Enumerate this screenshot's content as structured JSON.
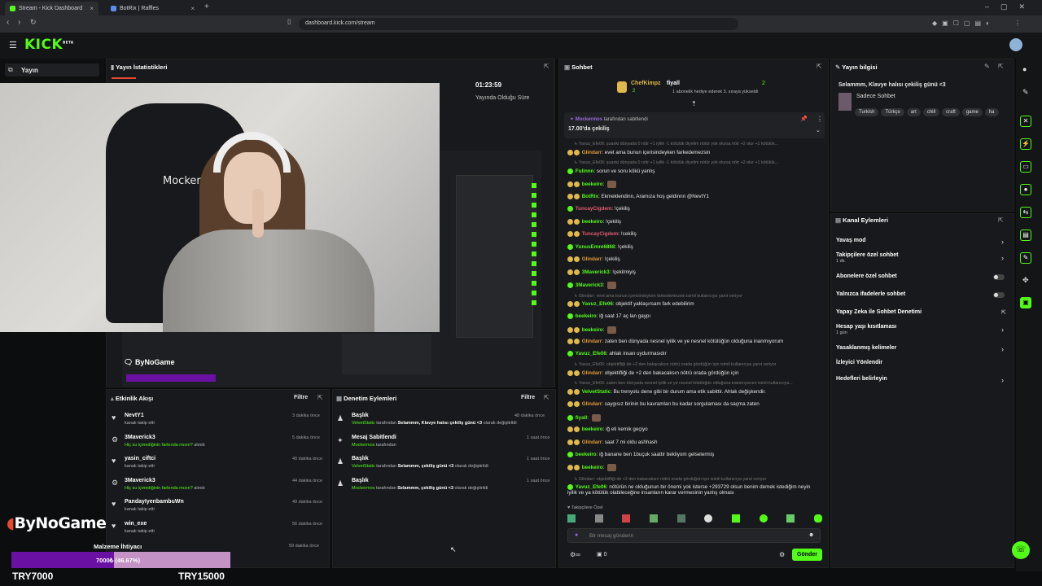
{
  "browser": {
    "tabs": [
      {
        "label": "Stream - Kick Dashboard",
        "active": true
      },
      {
        "label": "BotRix | Raffles",
        "active": false
      }
    ],
    "url": "dashboard.kick.com/stream"
  },
  "header": {
    "logo": "KICK",
    "logo_sup": "BETA"
  },
  "sidebar": {
    "label": "Yayın"
  },
  "stats": {
    "title": "Yayın İstatistikleri",
    "duration": "01:23:59",
    "duration_label": "Yayında Olduğu Süre"
  },
  "video": {
    "overlay_name": "Mockermo",
    "logo_small": "ByNoGame",
    "logo_big": "ByNoGame"
  },
  "activity": {
    "title": "Etkinlik Akışı",
    "filter": "Filtre",
    "items": [
      {
        "name": "NevtY1",
        "desc": "kanalı takip etti",
        "time": "3 dakika önce",
        "icon": "heart-icon"
      },
      {
        "name": "3Maverick3",
        "desc": "Hiç su içmediğinin farkında mısın?",
        "desc2": "alındı",
        "time": "5 dakika önce",
        "icon": "gift-icon"
      },
      {
        "name": "yasin_ciftci",
        "desc": "kanalı takip etti",
        "time": "40 dakika önce",
        "icon": "heart-icon"
      },
      {
        "name": "3Maverick3",
        "desc": "Hiç su içmediğinin farkında mısın?",
        "desc2": "alındı",
        "time": "44 dakika önce",
        "icon": "gift-icon"
      },
      {
        "name": "PandayIyenbambuWn",
        "desc": "kanalı takip etti",
        "time": "49 dakika önce",
        "icon": "heart-icon"
      },
      {
        "name": "win_exe",
        "desc": "kanalı takip etti",
        "time": "56 dakika önce",
        "icon": "heart-icon"
      },
      {
        "name": "Malzeme İhtiyacı",
        "desc": "",
        "time": "59 dakika önce",
        "icon": "heart-icon"
      }
    ]
  },
  "moderation": {
    "title": "Denetim Eylemleri",
    "filter": "Filtre",
    "items": [
      {
        "title": "Başlık",
        "actor": "VelvetStatic",
        "mid": "tarafından",
        "text": "Selammm, Klavye halısı çekiliş günü <3",
        "end": "olarak değiştirildi",
        "time": "48 dakika önce",
        "icon": "person-icon"
      },
      {
        "title": "Mesaj Sabitlendi",
        "actor": "Mockermos",
        "mid": "tarafından",
        "text": "",
        "end": "",
        "time": "1 saat önce",
        "icon": "pin-icon"
      },
      {
        "title": "Başlık",
        "actor": "VelvetStatic",
        "mid": "tarafından",
        "text": "Selammm, çekiliş günü <3",
        "end": "olarak değiştirildi",
        "time": "1 saat önce",
        "icon": "person-icon"
      },
      {
        "title": "Başlık",
        "actor": "Mockermos",
        "mid": "tarafından",
        "text": "Selammm, çekiliş günü <3",
        "end": "olarak değiştirildi",
        "time": "1 saat önce",
        "icon": "person-icon"
      }
    ]
  },
  "goal": {
    "label": "Malzeme İhtiyacı",
    "progress_text": "7000₺ (46.67%)",
    "progress": 0.4667,
    "current": "TRY7000",
    "target": "TRY15000"
  },
  "chat": {
    "title": "Sohbet",
    "top_gifter": "ChefKimpz",
    "top_gifter_count": "2",
    "top2": "fiyall",
    "top2_count": "2",
    "gift_note": "1 abonelik hediye ederek 3. sıraya yükseldi",
    "pinned_user": "Mockermos",
    "pinned_by": "tarafından sabitlendi",
    "pinned_text": "17.00'da çekiliş",
    "messages": [
      {
        "user": "Yavuz_Efe06",
        "text": "şuanki dünyada 0 nötr +1 iyilik -1 kötülük diyelim nötür yok olursa nötr +2 olur +1 kötülük...",
        "sys": true
      },
      {
        "user": "Glindarr",
        "text": "evet ama bunun içerisindeyken farkedemezsin",
        "color": "#e09a3a"
      },
      {
        "user": "Yavuz_Efe06",
        "text": "şuanki dünyada 0 nötr +1 iyilik -1 kötülük diyelim nötür yok olursa nötr +2 olur +1 kötülük...",
        "sys": true
      },
      {
        "user": "Fulinnn",
        "text": "sorun ve soru kökü yanlış",
        "color": "#53fc18"
      },
      {
        "user": "beekeiro",
        "text": "",
        "color": "#53fc18"
      },
      {
        "user": "BotRix",
        "text": "Ekmeklendinn, Aramıza hoş geldinnn @NevtY1",
        "color": "#53fc18"
      },
      {
        "user": "TuncayCigdem",
        "text": "!çekiliş",
        "color": "#e05d6f"
      },
      {
        "user": "beekeiro",
        "text": "!çekiliş",
        "color": "#53fc18"
      },
      {
        "user": "TuncayCigdem",
        "text": "!cekiliş",
        "color": "#e05d6f"
      },
      {
        "user": "YunusEmre6868",
        "text": "!çekiliş",
        "color": "#53fc18"
      },
      {
        "user": "Glindarr",
        "text": "!çekiliş",
        "color": "#e09a3a"
      },
      {
        "user": "3Maverick3",
        "text": "!çekilmiyiş",
        "color": "#53fc18"
      },
      {
        "user": "3Maverick3",
        "text": "",
        "color": "#53fc18"
      },
      {
        "user": "Glindarr",
        "text": "evet ama bunun içerisindeyken farkedemezsin isimli kullanıcıya yanıt veriyor",
        "sys": true
      },
      {
        "user": "Yavuz_Efe06",
        "text": "objektif yaklaşırsam fark edebilirim",
        "color": "#53fc18"
      },
      {
        "user": "beekeiro",
        "text": "iğ saat 17 aç lan gaypı",
        "color": "#53fc18"
      },
      {
        "user": "beekeiro",
        "text": "",
        "color": "#53fc18"
      },
      {
        "user": "Glindarr",
        "text": "zaten ben dünyada nesnel iyilik ve ye nesnel kötülüğün olduğuna inanmıyorum",
        "color": "#e09a3a"
      },
      {
        "user": "Yavuz_Efe06",
        "text": "ahlak insan uydurmasıdır",
        "color": "#53fc18"
      },
      {
        "user": "Yavuz_Efe06",
        "text": "objektifliği de +2 den bakacaksın nötrü orada gördüğün için isimli kullanıcıya yanıt veriyor",
        "sys": true
      },
      {
        "user": "Glindarr",
        "text": "objektifliği de +2 den bakacaksın nötrü orada gördüğün için",
        "color": "#e09a3a"
      },
      {
        "user": "Yavuz_Efe06",
        "text": "zaten ben dünyada nesnel iyilik ve ye nesnel kötülüğün olduğuna inanmıyorum isimli kullanıcıya...",
        "sys": true
      },
      {
        "user": "VelvetStatic",
        "text": "Bu trenyolu dene gibi bir durum ama etik sabittir. Ahlak değişkendir.",
        "color": "#53fc18"
      },
      {
        "user": "Glindarr",
        "text": "saygısız birinin bu kavramları bu kadar sorgulaması da saçma zaten",
        "color": "#e09a3a"
      },
      {
        "user": "fiyall",
        "text": "",
        "color": "#53fc18"
      },
      {
        "user": "beekeiro",
        "text": "iğ eti kemik geçiyo",
        "color": "#53fc18"
      },
      {
        "user": "Glindarr",
        "text": "saat 7 mi oldu ashhash",
        "color": "#e09a3a"
      },
      {
        "user": "beekeiro",
        "text": "iğ banane ben 1buçuk saattir bekliyom gelselermiş",
        "color": "#53fc18"
      },
      {
        "user": "beekeiro",
        "text": "",
        "color": "#53fc18"
      },
      {
        "user": "Glindarr",
        "text": "objektifliği de +2 den bakacaksın nötrü orada gördüğün için isimli kullanıcıya yanıt veriyor",
        "sys": true
      },
      {
        "user": "Yavuz_Efe06",
        "text": "nötürün ne olduğunun bir önemi yok isterse +293729 olsun benim demek istediğim neyin iyilik ve ya kötülük olabileceğine insanların karar vermesinin yanlış olması",
        "color": "#53fc18"
      }
    ],
    "emote_label": "Takipçilere Özel",
    "input_placeholder": "Bir mesaj gönderin",
    "send": "Gönder",
    "count": "0"
  },
  "stream_info": {
    "title": "Yayın bilgisi",
    "stream_title": "Selammm, Klavye halısı çekiliş günü <3",
    "category": "Sadece Sohbet",
    "tags": [
      "Turkish",
      "Türkçe",
      "art",
      "chill",
      "craft",
      "game",
      "ha"
    ]
  },
  "channel_actions": {
    "title": "Kanal Eylemleri",
    "items": [
      {
        "label": "Yavaş mod",
        "control": "chevron"
      },
      {
        "label": "Takipçilere özel sohbet",
        "sub": "1 dk.",
        "control": "chevron"
      },
      {
        "label": "Abonelere özel sohbet",
        "control": "toggle"
      },
      {
        "label": "Yalnızca ifadelerle sohbet",
        "control": "toggle"
      },
      {
        "label": "Yapay Zeka ile Sohbet Denetimi",
        "control": "external"
      },
      {
        "label": "Hesap yaşı kısıtlaması",
        "sub": "1 gün",
        "control": "chevron"
      },
      {
        "label": "Yasaklanmış kelimeler",
        "control": "chevron"
      },
      {
        "label": "İzleyici Yönlendir",
        "control": "none"
      },
      {
        "label": "Hedefleri belirleyin",
        "control": "chevron"
      }
    ]
  },
  "colors": {
    "accent": "#53fc18",
    "bg": "#0b0d0e",
    "panel": "#18191c"
  }
}
